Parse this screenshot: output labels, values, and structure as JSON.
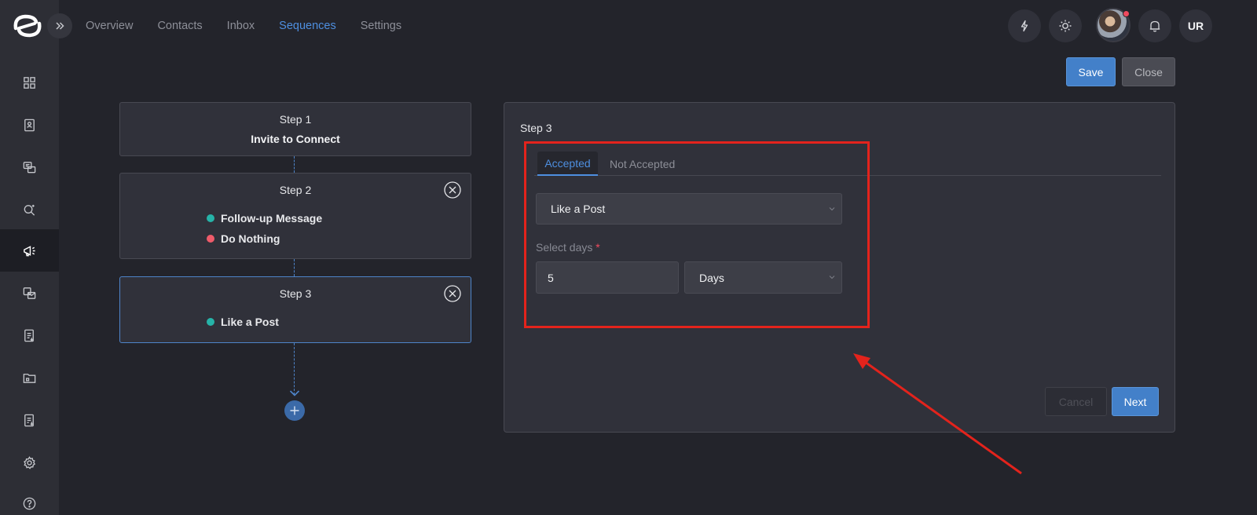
{
  "nav": {
    "tabs": [
      {
        "label": "Overview"
      },
      {
        "label": "Contacts"
      },
      {
        "label": "Inbox"
      },
      {
        "label": "Sequences",
        "active": true
      },
      {
        "label": "Settings"
      }
    ]
  },
  "user": {
    "initials": "UR"
  },
  "sidebar": {
    "items": [
      {
        "icon": "dashboard-icon"
      },
      {
        "icon": "contacts-book-icon"
      },
      {
        "icon": "chat-icon"
      },
      {
        "icon": "search-people-icon"
      },
      {
        "icon": "megaphone-icon",
        "active": true
      },
      {
        "icon": "email-campaign-icon"
      },
      {
        "icon": "document-list-icon"
      },
      {
        "icon": "folder-icon"
      },
      {
        "icon": "report-icon"
      },
      {
        "icon": "gear-icon"
      },
      {
        "icon": "help-icon"
      }
    ]
  },
  "actions": {
    "save": "Save",
    "close": "Close"
  },
  "steps": [
    {
      "title": "Step 1",
      "subtitle": "Invite to Connect"
    },
    {
      "title": "Step 2",
      "options": [
        {
          "label": "Follow-up Message",
          "color": "#26b3a8"
        },
        {
          "label": "Do Nothing",
          "color": "#ef5b6a"
        }
      ]
    },
    {
      "title": "Step 3",
      "options": [
        {
          "label": "Like a Post",
          "color": "#26b3a8"
        }
      ]
    }
  ],
  "panel": {
    "title": "Step 3",
    "tabs": {
      "accepted": "Accepted",
      "not_accepted": "Not Accepted"
    },
    "action_select": "Like a Post",
    "days_label": "Select days",
    "required_mark": "*",
    "days_value": "5",
    "unit_select": "Days",
    "cancel": "Cancel",
    "next": "Next"
  },
  "colors": {
    "accent": "#4380c9",
    "annotation": "#e3231c"
  }
}
